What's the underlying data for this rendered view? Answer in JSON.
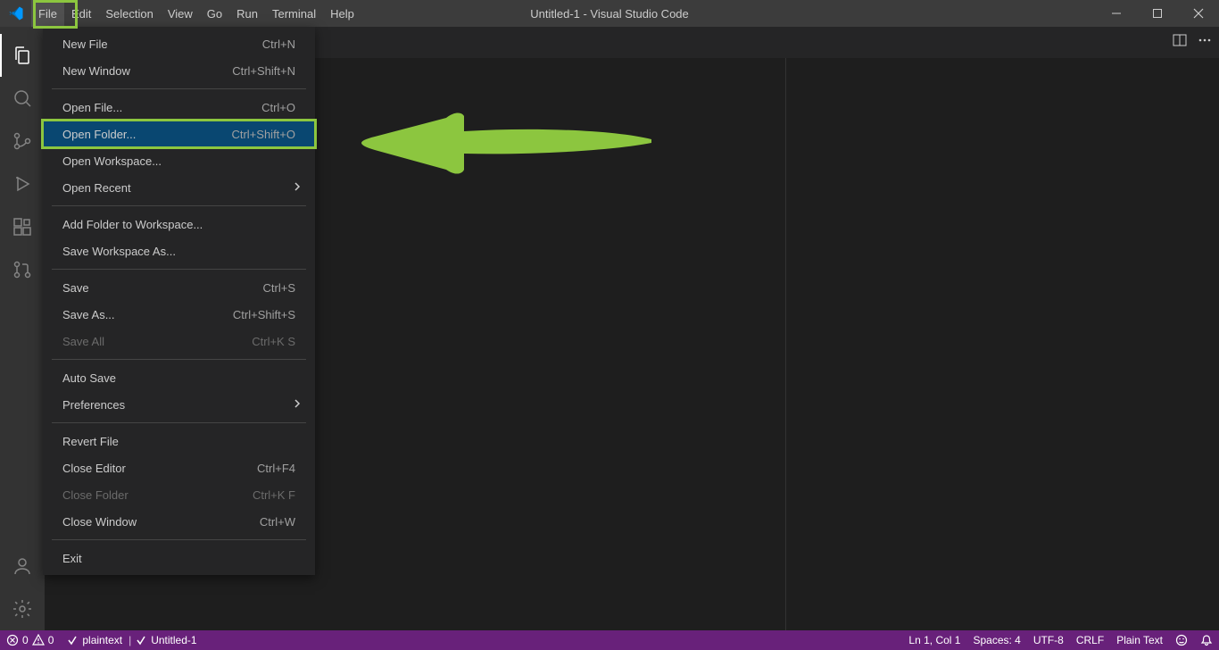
{
  "titlebar": {
    "menus": [
      "File",
      "Edit",
      "Selection",
      "View",
      "Go",
      "Run",
      "Terminal",
      "Help"
    ],
    "title": "Untitled-1 - Visual Studio Code"
  },
  "activitybar": {
    "items": [
      "explorer",
      "search",
      "source-control",
      "run-debug",
      "extensions",
      "git-pr"
    ],
    "bottom": [
      "account",
      "settings-gear"
    ]
  },
  "file_menu": {
    "groups": [
      [
        {
          "label": "New File",
          "shortcut": "Ctrl+N"
        },
        {
          "label": "New Window",
          "shortcut": "Ctrl+Shift+N"
        }
      ],
      [
        {
          "label": "Open File...",
          "shortcut": "Ctrl+O"
        },
        {
          "label": "Open Folder...",
          "shortcut": "Ctrl+Shift+O",
          "highlighted": true
        },
        {
          "label": "Open Workspace..."
        },
        {
          "label": "Open Recent",
          "submenu": true
        }
      ],
      [
        {
          "label": "Add Folder to Workspace..."
        },
        {
          "label": "Save Workspace As..."
        }
      ],
      [
        {
          "label": "Save",
          "shortcut": "Ctrl+S"
        },
        {
          "label": "Save As...",
          "shortcut": "Ctrl+Shift+S"
        },
        {
          "label": "Save All",
          "shortcut": "Ctrl+K S",
          "disabled": true
        }
      ],
      [
        {
          "label": "Auto Save"
        },
        {
          "label": "Preferences",
          "submenu": true
        }
      ],
      [
        {
          "label": "Revert File"
        },
        {
          "label": "Close Editor",
          "shortcut": "Ctrl+F4"
        },
        {
          "label": "Close Folder",
          "shortcut": "Ctrl+K F",
          "disabled": true
        },
        {
          "label": "Close Window",
          "shortcut": "Ctrl+W"
        }
      ],
      [
        {
          "label": "Exit"
        }
      ]
    ]
  },
  "statusbar": {
    "errors": "0",
    "warnings": "0",
    "language_mode_left": "plaintext",
    "filename": "Untitled-1",
    "line_col": "Ln 1, Col 1",
    "spaces": "Spaces: 4",
    "encoding": "UTF-8",
    "eol": "CRLF",
    "language": "Plain Text"
  },
  "annotation": {
    "color": "#8CC63F"
  }
}
